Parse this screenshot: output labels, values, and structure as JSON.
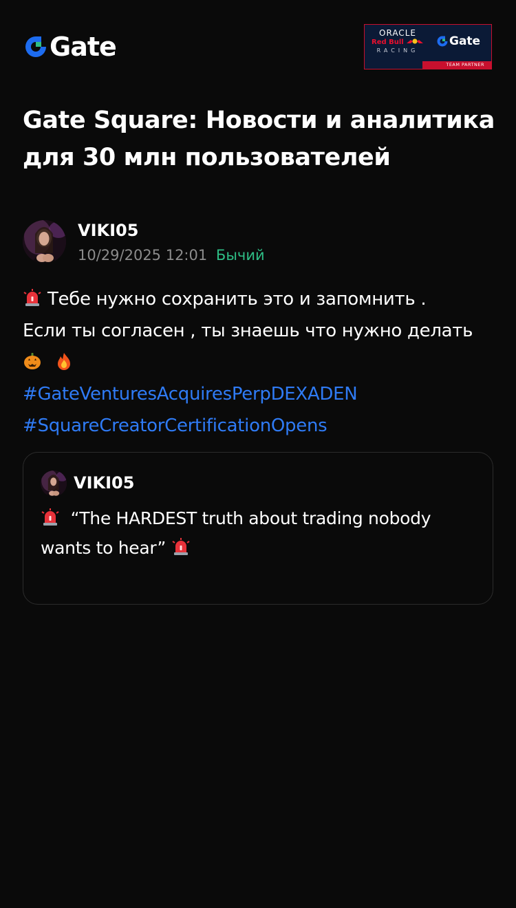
{
  "header": {
    "logo_text": "Gate",
    "logo_icon": "gate-logo-icon",
    "partner": {
      "oracle": "ORACLE",
      "redbull": "Red Bull",
      "racing": "RACING",
      "gate": "Gate",
      "team_partner": "TEAM PARTNER"
    },
    "colors": {
      "gate_blue": "#1d6cf0",
      "gate_green": "#2ebd85",
      "partner_red": "#c8102e",
      "partner_navy": "#0b1a36"
    }
  },
  "headline": "Gate Square: Новости и аналитика для 30 млн пользователей",
  "post": {
    "author": {
      "name": "VIKI05",
      "avatar": "user-avatar"
    },
    "time": "10/29/2025 12:01",
    "sentiment": "Бычий",
    "lines": [
      "Тебе нужно сохранить это и запомнить .",
      "Если ты согласен , ты знаешь что нужно делать"
    ],
    "emoji_icons": [
      "siren-emoji",
      "pumpkin-emoji",
      "fire-emoji"
    ],
    "hashtags": [
      "#GateVenturesAcquiresPerpDEXADEN",
      "#SquareCreatorCertificationOpens"
    ],
    "colors": {
      "hashtag": "#2f7bf5",
      "sentiment_bullish": "#2ebd85",
      "muted": "#8c8c8c"
    }
  },
  "quoted_post": {
    "author": "VIKI05",
    "text_line1": "“The HARDEST truth about trading nobody",
    "text_line2": "wants to hear”"
  }
}
